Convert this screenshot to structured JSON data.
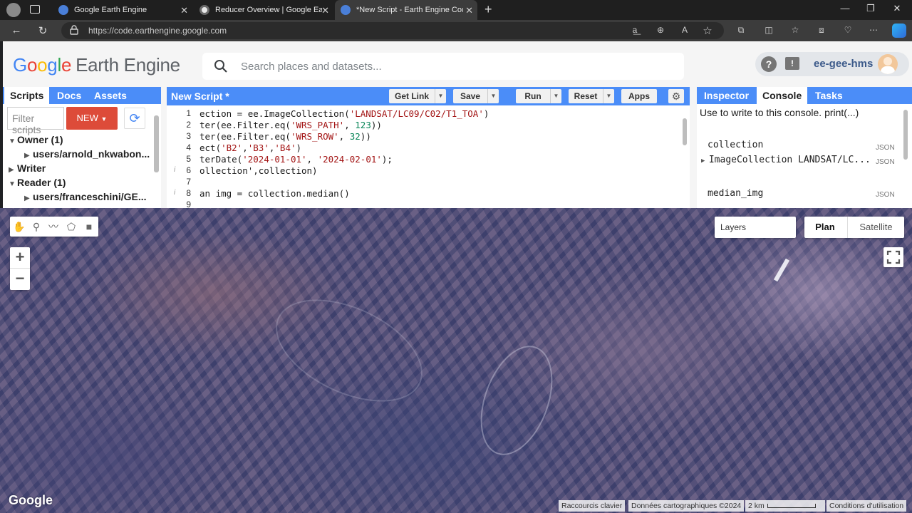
{
  "browser": {
    "tabs": [
      {
        "title": "Google Earth Engine"
      },
      {
        "title": "Reducer Overview | Google Eart"
      },
      {
        "title": "*New Script - Earth Engine Code"
      }
    ],
    "url": "https://code.earthengine.google.com"
  },
  "header": {
    "logo_google": [
      "G",
      "o",
      "o",
      "g",
      "l",
      "e"
    ],
    "logo_product": "Earth Engine",
    "search_placeholder": "Search places and datasets...",
    "username": "ee-gee-hms"
  },
  "left_panel": {
    "tabs": [
      "Scripts",
      "Docs",
      "Assets"
    ],
    "filter_placeholder": "Filter scripts",
    "new_button": "NEW",
    "tree": [
      {
        "label": "Owner (1)",
        "expanded": true
      },
      {
        "label": "users/arnold_nkwabon...",
        "child": true
      },
      {
        "label": "Writer",
        "expanded": false
      },
      {
        "label": "Reader (1)",
        "expanded": true
      },
      {
        "label": "users/franceschini/GE...",
        "child": true
      }
    ]
  },
  "editor": {
    "title": "New Script *",
    "buttons": {
      "get_link": "Get Link",
      "save": "Save",
      "run": "Run",
      "reset": "Reset",
      "apps": "Apps"
    },
    "lines": [
      {
        "n": "1",
        "text": "ection = ee.ImageCollection('LANDSAT/LC09/C02/T1_TOA')"
      },
      {
        "n": "2",
        "text": "ter(ee.Filter.eq('WRS_PATH', 123))"
      },
      {
        "n": "3",
        "text": "ter(ee.Filter.eq('WRS_ROW', 32))"
      },
      {
        "n": "4",
        "text": "ect('B2','B3','B4')"
      },
      {
        "n": "5",
        "text": "terDate('2024-01-01', '2024-02-01');"
      },
      {
        "n": "6",
        "text": "ollection',collection)",
        "info": true
      },
      {
        "n": "7",
        "text": ""
      },
      {
        "n": "8",
        "text": "an img = collection.median()",
        "info": true
      },
      {
        "n": "9",
        "text": ""
      }
    ]
  },
  "console": {
    "tabs": [
      "Inspector",
      "Console",
      "Tasks"
    ],
    "hint": "Use to write to this console. print(...)",
    "entries": [
      {
        "label": "collection",
        "tag": "JSON"
      },
      {
        "label": "ImageCollection LANDSAT/LC...",
        "tag": "JSON",
        "expandable": true
      },
      {
        "label": "median_img",
        "tag": "JSON"
      }
    ]
  },
  "map": {
    "layers_label": "Layers",
    "map_types": [
      "Plan",
      "Satellite"
    ],
    "zoom_in": "+",
    "zoom_out": "−",
    "google_logo": "Google",
    "attribution": [
      "Raccourcis clavier",
      "Données cartographiques ©2024",
      "2 km",
      "Conditions d'utilisation"
    ]
  },
  "colors": {
    "accent": "#4b8df8",
    "new_button": "#dd4b39"
  }
}
